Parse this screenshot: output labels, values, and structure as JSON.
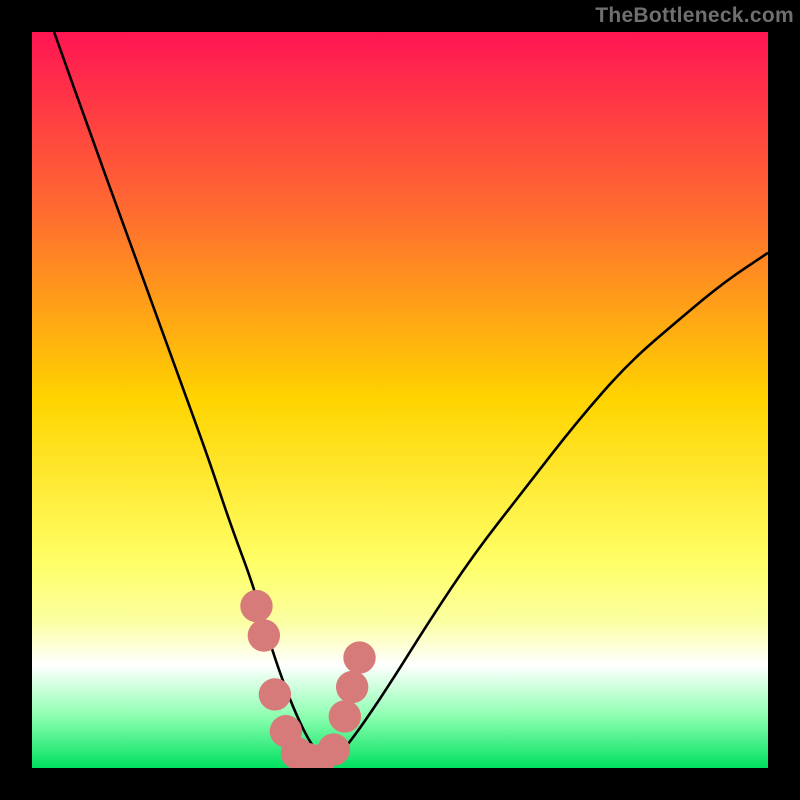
{
  "watermark": "TheBottleneck.com",
  "chart_data": {
    "type": "line",
    "title": "",
    "xlabel": "",
    "ylabel": "",
    "xlim": [
      0,
      100
    ],
    "ylim": [
      0,
      100
    ],
    "gradient_stops": [
      {
        "pct": 0.0,
        "color": "#ff1553"
      },
      {
        "pct": 0.25,
        "color": "#ff6e2f"
      },
      {
        "pct": 0.5,
        "color": "#ffd400"
      },
      {
        "pct": 0.72,
        "color": "#ffff66"
      },
      {
        "pct": 0.8,
        "color": "#fbffa0"
      },
      {
        "pct": 0.86,
        "color": "#ffffff"
      },
      {
        "pct": 0.93,
        "color": "#8cffb0"
      },
      {
        "pct": 1.0,
        "color": "#00e060"
      }
    ],
    "curve": {
      "name": "bottleneck-curve",
      "color": "#000000",
      "x": [
        3,
        8,
        12,
        16,
        20,
        24,
        27,
        30,
        32,
        34,
        36,
        38,
        40,
        42,
        45,
        49,
        54,
        60,
        67,
        74,
        81,
        88,
        94,
        100
      ],
      "y": [
        100,
        86,
        75,
        64,
        53,
        42,
        33,
        25,
        18,
        12,
        7,
        3,
        1,
        2,
        6,
        12,
        20,
        29,
        38,
        47,
        55,
        61,
        66,
        70
      ]
    },
    "points": {
      "name": "data-points",
      "color": "#d77a7a",
      "radius": 2.2,
      "x": [
        30.5,
        31.5,
        33.0,
        34.5,
        36.0,
        37.5,
        39.0,
        41.0,
        42.5,
        43.5,
        44.5
      ],
      "y": [
        22.0,
        18.0,
        10.0,
        5.0,
        2.0,
        1.2,
        1.0,
        2.5,
        7.0,
        11.0,
        15.0
      ]
    }
  }
}
